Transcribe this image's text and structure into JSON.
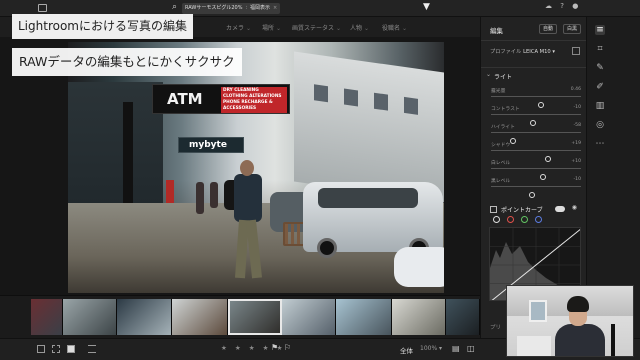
{
  "overlay": {
    "title": "Lightroomにおける写真の編集",
    "subtitle": "RAWデータの編集もとにかくサクサク"
  },
  "topbar": {
    "search_chips": [
      {
        "label": "RAWサーモスピグル20%",
        "close": "×"
      },
      {
        "label": "福岡表示",
        "close": "×"
      }
    ]
  },
  "filterbar": {
    "items": [
      "カメラ",
      "場所",
      "画質ステータス",
      "人物",
      "役職名"
    ]
  },
  "photo": {
    "atm_sign": "ATM",
    "atm_services": [
      "DRY CLEANING",
      "CLOTHING ALTERATIONS",
      "PHONE RECHARGE &",
      "ACCESSORIES"
    ],
    "store_sign": "mybyte"
  },
  "bottombar": {
    "stars": "★ ★ ★ ★ ★",
    "fit_label": "全体",
    "zoom": "100% ▾"
  },
  "right_panel": {
    "title": "編集",
    "btn_auto": "自動",
    "btn_bw": "白黒",
    "profile_label": "プロファイル",
    "profile_value": "LEICA M10 ▾",
    "light_section": "ライト",
    "sliders": [
      {
        "label": "露光量",
        "value": "0.46",
        "pct": 0.55
      },
      {
        "label": "コントラスト",
        "value": "-10",
        "pct": 0.47
      },
      {
        "label": "ハイライト",
        "value": "-58",
        "pct": 0.24
      },
      {
        "label": "シャドウ",
        "value": "+19",
        "pct": 0.63
      },
      {
        "label": "白レベル",
        "value": "+10",
        "pct": 0.58
      },
      {
        "label": "黒レベル",
        "value": "-10",
        "pct": 0.46
      }
    ],
    "point_curve": "ポイントカーブ",
    "footer": "プリ"
  },
  "colors": {
    "accent": "#ffffff",
    "atm_red": "#c0262a",
    "panel_bg": "#222222"
  },
  "icons": {
    "rail": [
      "sliders-icon",
      "crop-icon",
      "healing-icon",
      "brush-icon",
      "gradient-icon",
      "radial-icon",
      "more-icon"
    ]
  }
}
